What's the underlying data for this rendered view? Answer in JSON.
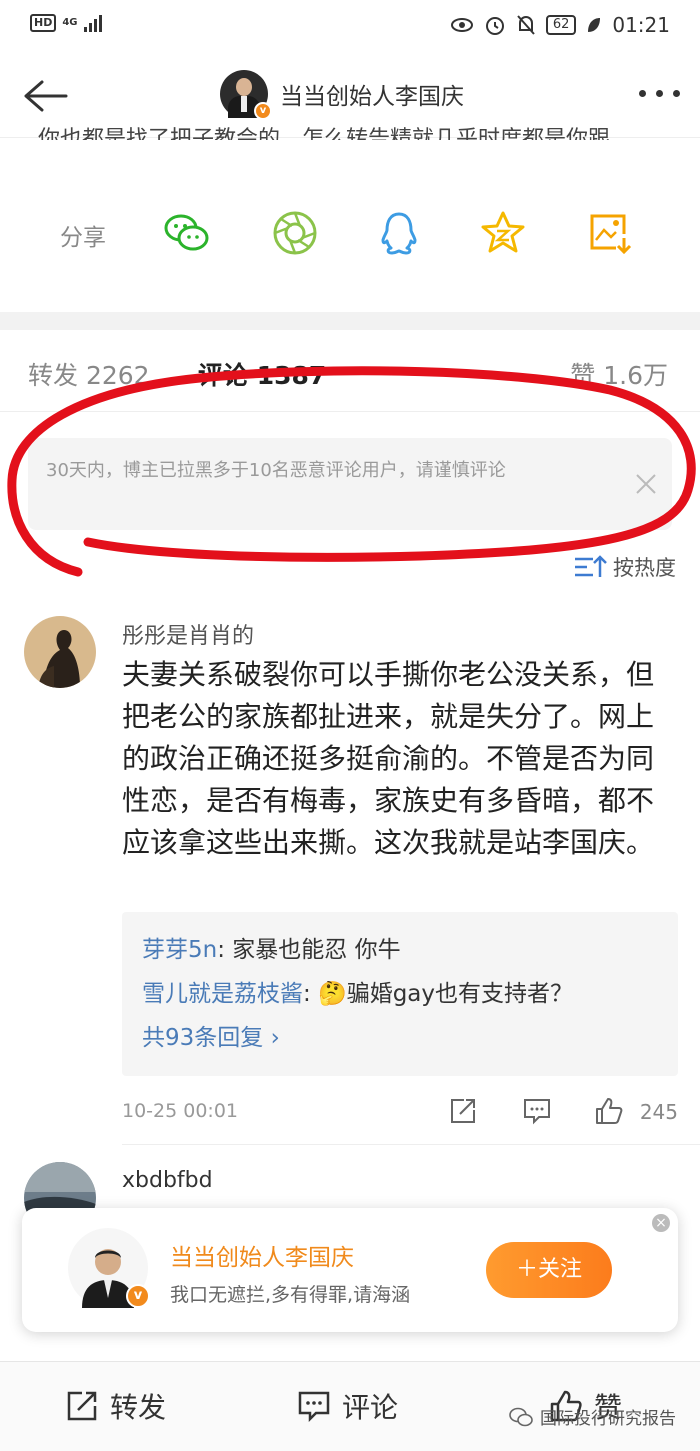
{
  "status_bar": {
    "hd": "HD",
    "network": "4G",
    "battery": "62",
    "time": "01:21"
  },
  "nav": {
    "title": "当当创始人李国庆"
  },
  "post": {
    "cutoff_text": "你也都是找了把子教会的，怎么转告精就几乎时度都是你跟"
  },
  "share": {
    "label": "分享",
    "icons": [
      "wechat-icon",
      "moments-icon",
      "qq-icon",
      "qzone-icon",
      "save-image-icon"
    ]
  },
  "tabs": {
    "repost": "转发 2262",
    "comment": "评论 1387",
    "like": "赞 1.6万"
  },
  "notice": {
    "text": "30天内，博主已拉黑多于10名恶意评论用户，请谨慎评论"
  },
  "sort": {
    "label": "按热度"
  },
  "comments": [
    {
      "user": "彤彤是肖肖的",
      "body": "夫妻关系破裂你可以手撕你老公没关系，但把老公的家族都扯进来，就是失分了。网上的政治正确还挺多挺俞渝的。不管是否为同性恋，是否有梅毒，家族史有多昏暗，都不应该拿这些出来撕。这次我就是站李国庆。",
      "replies": [
        {
          "name": "芽芽5n",
          "text": "家暴也能忍 你牛"
        },
        {
          "name": "雪儿就是荔枝酱",
          "text": "🤔骗婚gay也有支持者？"
        }
      ],
      "more_replies": "共93条回复 ›",
      "time": "10-25 00:01",
      "likes": "245"
    },
    {
      "user": "xbdbfbd"
    }
  ],
  "popup": {
    "name": "当当创始人李国庆",
    "sub": "我口无遮拦,多有得罪,请海涵",
    "follow": "＋关注",
    "close": "×"
  },
  "bottom_bar": {
    "repost": "转发",
    "comment": "评论",
    "like": "赞"
  },
  "watermark": {
    "text": "国际投行研究报告"
  },
  "colors": {
    "accent_orange": "#f28a1c",
    "link_blue": "#4a7bb7",
    "marker_red": "#e3101b",
    "share_green": "#2bb32b",
    "share_blue": "#3d9ce3",
    "share_yellow": "#f5b800"
  }
}
